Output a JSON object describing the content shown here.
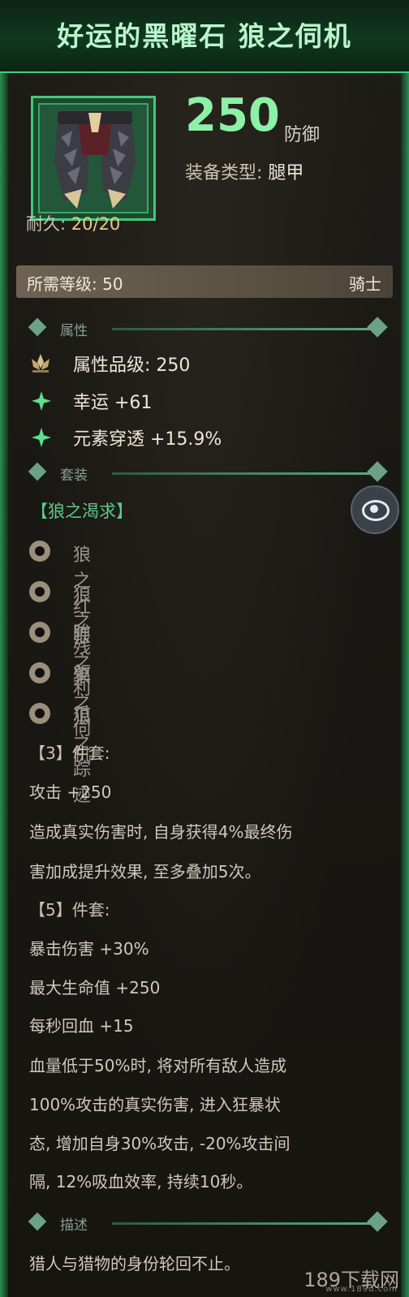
{
  "title": "好运的黑曜石 狼之伺机",
  "item": {
    "defense_value": "250",
    "defense_label": "防御",
    "equip_type_label": "装备类型:",
    "equip_type_value": "腿甲",
    "durability_label": "耐久:",
    "durability_value": "20/20",
    "required_level_text": "所需等级: 50",
    "required_class": "骑士"
  },
  "attributes": {
    "heading": "属性",
    "quality": "属性品级: 250",
    "luck": "幸运 +61",
    "elemental_pen": "元素穿透 +15.9%"
  },
  "set": {
    "heading": "套装",
    "name": "【狼之渴求】",
    "pieces": [
      "狼之红眸",
      "狼之残躯",
      "狼之利爪",
      "狼之伺机",
      "狼之踪迹"
    ],
    "bonus3_head": "【3】件套:",
    "bonus3_lines": [
      "攻击 +250",
      "造成真实伤害时, 自身获得4%最终伤",
      "害加成提升效果, 至多叠加5次。"
    ],
    "bonus5_head": "【5】件套:",
    "bonus5_lines": [
      "暴击伤害 +30%",
      "最大生命值 +250",
      "每秒回血 +15",
      "血量低于50%时, 将对所有敌人造成",
      "100%攻击的真实伤害, 进入狂暴状",
      "态, 增加自身30%攻击, -20%攻击间",
      "隔, 12%吸血效率, 持续10秒。"
    ]
  },
  "description": {
    "heading": "描述",
    "text": "猎人与猎物的身份轮回不止。"
  },
  "watermark": {
    "text": "189下载网",
    "url": "www.189d.com"
  },
  "colors": {
    "accent_green": "#8df0a7",
    "title_green": "#b9f5cc",
    "set_green": "#5ec98a",
    "durability_gold": "#e9c98a"
  },
  "icons": {
    "quality": "lotus-icon",
    "luck": "sparkle-icon",
    "pen": "sparkle-icon",
    "view": "eye-icon"
  }
}
